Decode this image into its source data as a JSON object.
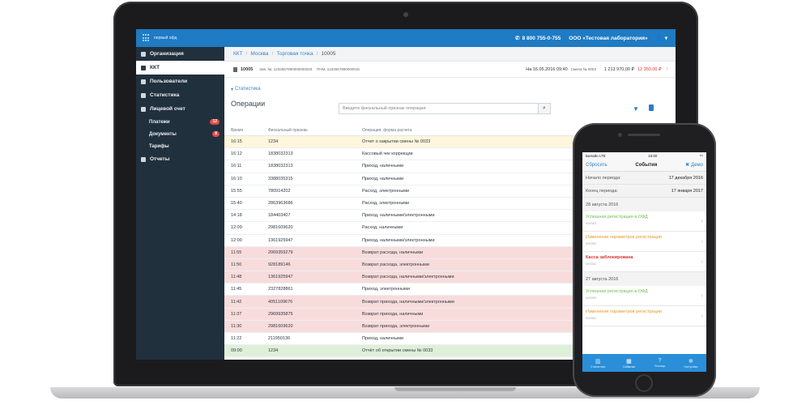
{
  "app": {
    "logo_text": "первый офд",
    "phone": "8 800 755-0-755",
    "org": "ООО «Тестовая лаборатория»"
  },
  "sidebar": {
    "items": [
      {
        "label": "Организация",
        "icon": "building-icon"
      },
      {
        "label": "ККТ",
        "icon": "register-icon"
      },
      {
        "label": "Пользователи",
        "icon": "user-icon"
      },
      {
        "label": "Статистика",
        "icon": "chart-icon"
      },
      {
        "label": "Лицевой счет",
        "icon": "wallet-icon"
      }
    ],
    "subitems": [
      {
        "label": "Платежи",
        "badge": "12"
      },
      {
        "label": "Документы",
        "badge": "8"
      },
      {
        "label": "Тарифы",
        "badge": ""
      }
    ],
    "last_item": {
      "label": "Отчеты",
      "icon": "file-icon"
    }
  },
  "breadcrumb": {
    "items": [
      "ККТ",
      "Москва",
      "Торговая точка"
    ],
    "current": "10005"
  },
  "kkt": {
    "number": "10005",
    "zn": "Зав. №: 1234567890000000020",
    "rnm": "РНМ: 1234567890000016",
    "status": "На 16.05.2016 09:40",
    "shift_label": "Смена № 0003",
    "total": "1 213 970,00 ₽",
    "amount_red": "12 350,00 ₽"
  },
  "stats_link": "Статистика",
  "ops": {
    "title": "Операции",
    "search_placeholder": "Введите фискальный признак операции"
  },
  "table": {
    "headers": [
      "Время",
      "Фискальный признак",
      "Операция, форма расчета"
    ],
    "rows": [
      {
        "time": "16:15",
        "fp": "1234",
        "op": "Отчет о закрытии смены № 0033",
        "status": "yellow"
      },
      {
        "time": "16:12",
        "fp": "1838032313",
        "op": "Кассовый чек коррекции",
        "status": ""
      },
      {
        "time": "16:11",
        "fp": "1838032313",
        "op": "Приход, наличными",
        "status": ""
      },
      {
        "time": "16:10",
        "fp": "3388035315",
        "op": "Приход, наличными",
        "status": ""
      },
      {
        "time": "15:55",
        "fp": "780914202",
        "op": "Расход, электронными",
        "status": ""
      },
      {
        "time": "15:40",
        "fp": "2863963686",
        "op": "Расход, электронными",
        "status": ""
      },
      {
        "time": "14:18",
        "fp": "184403407",
        "op": "Приход, наличными/электронными",
        "status": ""
      },
      {
        "time": "12:09",
        "fp": "2981609620",
        "op": "Расход, наличными",
        "status": ""
      },
      {
        "time": "12:00",
        "fp": "1361925947",
        "op": "Приход, наличными/электронными",
        "status": ""
      },
      {
        "time": "11:55",
        "fp": "2069359279",
        "op": "Возврат расхода, наличными",
        "status": "red"
      },
      {
        "time": "11:50",
        "fp": "928189146",
        "op": "Возврат расхода, электронными",
        "status": "red"
      },
      {
        "time": "11:48",
        "fp": "1361925947",
        "op": "Возврат расхода, наличными/электронными",
        "status": "red"
      },
      {
        "time": "11:45",
        "fp": "2327828861",
        "op": "Приход, электронными",
        "status": ""
      },
      {
        "time": "11:42",
        "fp": "4051109676",
        "op": "Возврат прихода, наличными/электронными",
        "status": "red"
      },
      {
        "time": "11:37",
        "fp": "2969935875",
        "op": "Возврат прихода, наличными",
        "status": "red"
      },
      {
        "time": "11:30",
        "fp": "2981609620",
        "op": "Возврат прихода, электронными",
        "status": "red"
      },
      {
        "time": "11:22",
        "fp": "211950136",
        "op": "Приход, наличными",
        "status": ""
      },
      {
        "time": "09:00",
        "fp": "1234",
        "op": "Отчёт об открытии смены № 0033",
        "status": "green"
      }
    ]
  },
  "phone": {
    "carrier": "Билайн LTE",
    "time": "16:50",
    "battery": "",
    "nav_left": "Сбросить",
    "nav_title": "События",
    "nav_right": "Демо",
    "period_start_label": "Начало периода:",
    "period_start_value": "17 декабря 2016",
    "period_end_label": "Конец периода:",
    "period_end_value": "17 января 2017",
    "date1": "28 августа 2016",
    "events1": [
      {
        "title": "Успешная регистрация в ОФД",
        "id": "000353",
        "color": "green"
      },
      {
        "title": "Изменение параметров регистрации",
        "id": "000351",
        "color": "orange"
      },
      {
        "title": "Касса заблокирована",
        "id": "000352",
        "color": "red"
      }
    ],
    "date2": "27 августа 2016",
    "events2": [
      {
        "title": "Успешная регистрация в ОФД",
        "id": "000353",
        "color": "green"
      },
      {
        "title": "Изменение параметров регистрации",
        "id": "000351",
        "color": "orange"
      }
    ],
    "tabs": [
      {
        "label": "Статистика",
        "icon": "chart-icon"
      },
      {
        "label": "События",
        "icon": "calendar-icon"
      },
      {
        "label": "Помощь",
        "icon": "help-icon"
      },
      {
        "label": "Настройки",
        "icon": "gear-icon"
      }
    ]
  }
}
